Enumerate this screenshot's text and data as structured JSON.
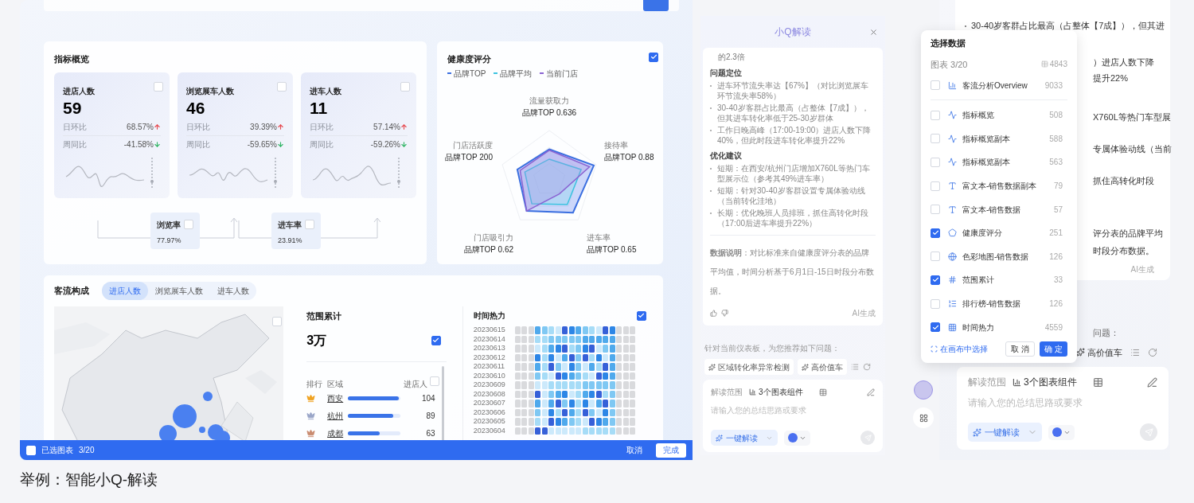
{
  "dashboard": {
    "overview": {
      "title": "指标概览",
      "cards": [
        {
          "label": "进店人数",
          "value": "59",
          "checked": false,
          "rows": [
            {
              "label": "日环比",
              "value": "68.57%",
              "up": true
            },
            {
              "label": "周同比",
              "value": "-41.58%",
              "up": false
            }
          ]
        },
        {
          "label": "浏览展车人数",
          "value": "46",
          "checked": false,
          "rows": [
            {
              "label": "日环比",
              "value": "39.39%",
              "up": true
            },
            {
              "label": "周同比",
              "value": "-59.65%",
              "up": false
            }
          ]
        },
        {
          "label": "进车人数",
          "value": "11",
          "checked": false,
          "rows": [
            {
              "label": "日环比",
              "value": "57.14%",
              "up": true
            },
            {
              "label": "周同比",
              "value": "-59.26%",
              "up": false
            }
          ]
        }
      ],
      "rates": [
        {
          "label": "浏览率",
          "value": "77.97%",
          "checked": false
        },
        {
          "label": "进车率",
          "value": "23.91%",
          "checked": false
        }
      ]
    },
    "health": {
      "title": "健康度评分",
      "checked": true,
      "legend": [
        {
          "label": "品牌TOP",
          "color": "#3b6fe0"
        },
        {
          "label": "品牌平均",
          "color": "#3cc3e0"
        },
        {
          "label": "当前门店",
          "color": "#8a63d2"
        }
      ],
      "axes": [
        {
          "name": "流量获取力",
          "value": "品牌TOP 0.636"
        },
        {
          "name": "门店活跃度",
          "value": "品牌TOP 200"
        },
        {
          "name": "接待率",
          "value": "品牌TOP 0.88"
        },
        {
          "name": "门店吸引力",
          "value": "品牌TOP 0.62"
        },
        {
          "name": "进车率",
          "value": "品牌TOP 0.65"
        }
      ]
    },
    "flow": {
      "title": "客流构成",
      "tabs": [
        {
          "label": "进店人数",
          "selected": true
        },
        {
          "label": "浏览展车人数",
          "selected": false
        },
        {
          "label": "进车人数",
          "selected": false
        }
      ],
      "range": {
        "title": "范围累计",
        "value": "3万",
        "checked": true,
        "columns": [
          "排行",
          "区域",
          "进店人"
        ],
        "header_checked": false,
        "rows": [
          {
            "region": "西安",
            "level": 0.97,
            "count": "104",
            "color": "#f0a323"
          },
          {
            "region": "杭州",
            "level": 0.86,
            "count": "89",
            "color": "#9aa6c8"
          },
          {
            "region": "成都",
            "level": 0.6,
            "count": "63",
            "color": "#c98b70"
          }
        ]
      },
      "heat": {
        "title": "时间热力",
        "checked": true,
        "dates": [
          "20230615",
          "20230614",
          "20230613",
          "20230612",
          "20230611",
          "20230610",
          "20230609",
          "20230608",
          "20230607",
          "20230606",
          "20230605",
          "20230604"
        ]
      }
    },
    "selection_bar": {
      "checked": false,
      "label": "已选图表",
      "count": "3/20",
      "cancel": "取消",
      "done": "完成"
    }
  },
  "interpret_panel": {
    "title": "小Q解读",
    "lead": "的2.3倍",
    "sections": [
      {
        "heading": "问题定位",
        "items": [
          "进车环节流失率达【67%】（对比浏览展车环节流失率58%）",
          "30-40岁客群占比最高（占整体【7成】），但其进车转化率低于25-30岁群体",
          "工作日晚高峰（17:00-19:00）进店人数下降40%，但此时段进车转化率提升22%"
        ]
      },
      {
        "heading": "优化建议",
        "items": [
          "短期：在西安/杭州门店增加X760L等热门车型展示位（参考其49%进车率）",
          "短期：针对30-40岁客群设置专属体验动线（当前转化洼地）",
          "长期：优化晚班人员排班，抓住高转化时段（17:00后进车率提升22%）"
        ]
      }
    ],
    "note": "**数据说明**：对比标准来自健康度评分表的品牌平均值，时间分析基于6月1日-15日时段分布数据。",
    "ai_tag": "AI生成",
    "suggest_prompt": "针对当前仪表板，为您推荐如下问题：",
    "chips": [
      "区域转化率异常检测",
      "高价值车"
    ],
    "input": {
      "scope_label": "解读范围",
      "scope": "3个图表组件",
      "placeholder": "请输入您的总结思路或要求",
      "action": "一键解读"
    }
  },
  "right_panel": {
    "fragments": [
      {
        "kind": "bullet",
        "text": "30-40岁客群占比最高（占整体【7成】），但其进"
      },
      {
        "kind": "fragment",
        "text": "）进店人数下降"
      },
      {
        "kind": "fragment",
        "text": "提升22%"
      },
      {
        "kind": "fragment",
        "text": "X760L等热门车型展"
      },
      {
        "kind": "fragment",
        "text": "专属体验动线（当前"
      },
      {
        "kind": "fragment",
        "text": "抓住高转化时段"
      },
      {
        "kind": "fragment",
        "text": "评分表的品牌平均"
      },
      {
        "kind": "fragment",
        "text": "时段分布数据。"
      }
    ],
    "ai_tag": "AI生成",
    "suggest_prompt": "问题：",
    "chips": [
      "高价值车"
    ],
    "input": {
      "scope_label": "解读范围",
      "scope": "3个图表组件",
      "placeholder": "请输入您的总结思路或要求",
      "action": "一键解读"
    }
  },
  "select_popup": {
    "title": "选择数据",
    "count": "图表 3/20",
    "total": "4843",
    "items": [
      {
        "label": "客流分析Overview",
        "count": "9033",
        "kind": "overview",
        "checked": false
      },
      {
        "label": "指标概览",
        "count": "508",
        "kind": "metric",
        "checked": false
      },
      {
        "label": "指标概览副本",
        "count": "588",
        "kind": "metric",
        "checked": false
      },
      {
        "label": "指标概览副本",
        "count": "563",
        "kind": "metric",
        "checked": false
      },
      {
        "label": "富文本-销售数据副本",
        "count": "79",
        "kind": "text",
        "checked": false
      },
      {
        "label": "富文本-销售数据",
        "count": "57",
        "kind": "text",
        "checked": false
      },
      {
        "label": "健康度评分",
        "count": "251",
        "kind": "radar",
        "checked": true
      },
      {
        "label": "色彩地图-销售数据",
        "count": "126",
        "kind": "map",
        "checked": false
      },
      {
        "label": "范围累计",
        "count": "33",
        "kind": "number",
        "checked": true
      },
      {
        "label": "排行榜-销售数据",
        "count": "126",
        "kind": "rank",
        "checked": false
      },
      {
        "label": "时间热力",
        "count": "4559",
        "kind": "heat",
        "checked": true
      }
    ],
    "canvas_pick": "在画布中选择",
    "cancel": "取 消",
    "confirm": "确 定"
  },
  "caption": "举例：智能小Q-解读"
}
